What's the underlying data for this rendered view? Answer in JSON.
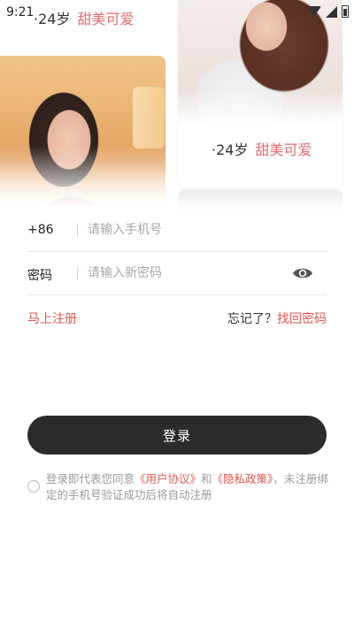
{
  "status_bar": {
    "time": "9:21",
    "icons": [
      "wifi-icon",
      "signal-icon",
      "battery-icon"
    ]
  },
  "profiles": {
    "top_caption": {
      "age": "·24岁",
      "tag": "甜美可爱"
    },
    "card_caption": {
      "age": "·24岁",
      "tag": "甜美可爱"
    }
  },
  "form": {
    "country_code": "+86",
    "phone_placeholder": "请输入手机号",
    "password_label": "密码",
    "password_placeholder": "请输入新密码",
    "password_toggle_icon": "eye-icon"
  },
  "links": {
    "register": "马上注册",
    "forgot_question": "忘记了？",
    "recover": "找回密码"
  },
  "login_button": "登录",
  "agreement": {
    "prefix": "登录即代表您同意",
    "user_agreement": "《用户协议》",
    "and": "和",
    "privacy_policy": "《隐私政策》",
    "suffix": "，未注册绑定的手机号验证成功后将自动注册"
  },
  "colors": {
    "accent": "#e4574f",
    "tag": "#e46b72",
    "button": "#2b2b2b"
  }
}
